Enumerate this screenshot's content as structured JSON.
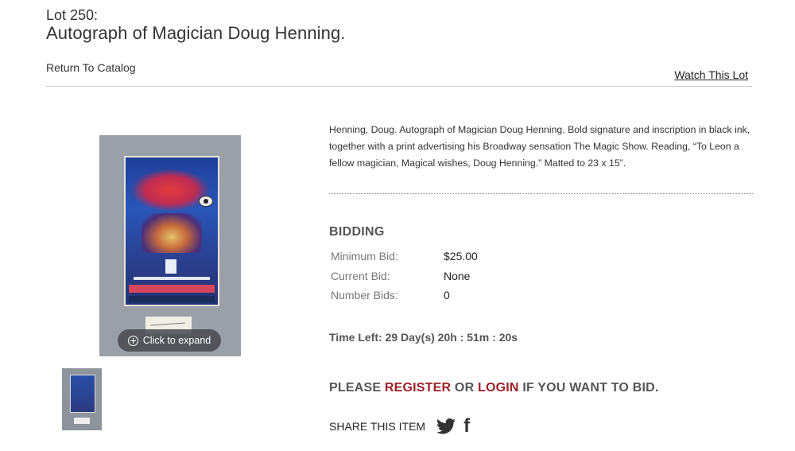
{
  "header": {
    "lot_number": "Lot 250:",
    "title": "Autograph of Magician Doug Henning.",
    "return_link": "Return To Catalog",
    "watch_link": "Watch This Lot"
  },
  "gallery": {
    "expand_label": "Click to expand",
    "main_image_icon": "poster-image",
    "thumbnail_icon": "poster-thumbnail"
  },
  "description": "Henning, Doug. Autograph of Magician Doug Henning. Bold signature and inscription in black ink, together with a print advertising his Broadway sensation The Magic Show. Reading, “To Leon a fellow magician, Magical wishes, Doug Henning.” Matted to 23 x 15”.",
  "bidding": {
    "heading": "BIDDING",
    "rows": [
      {
        "label": "Minimum Bid:",
        "value": "$25.00"
      },
      {
        "label": "Current Bid:",
        "value": "None"
      },
      {
        "label": "Number Bids:",
        "value": "0"
      }
    ],
    "time_left": "Time Left: 29 Day(s) 20h : 51m : 20s"
  },
  "cta": {
    "prefix": "PLEASE",
    "register": "REGISTER",
    "or": "OR",
    "login": "LOGIN",
    "suffix": "IF YOU WANT TO BID.",
    "link_color": "#9c2027"
  },
  "share": {
    "label": "SHARE THIS ITEM",
    "icons": [
      "twitter-icon",
      "facebook-icon"
    ],
    "facebook_glyph": "f"
  }
}
